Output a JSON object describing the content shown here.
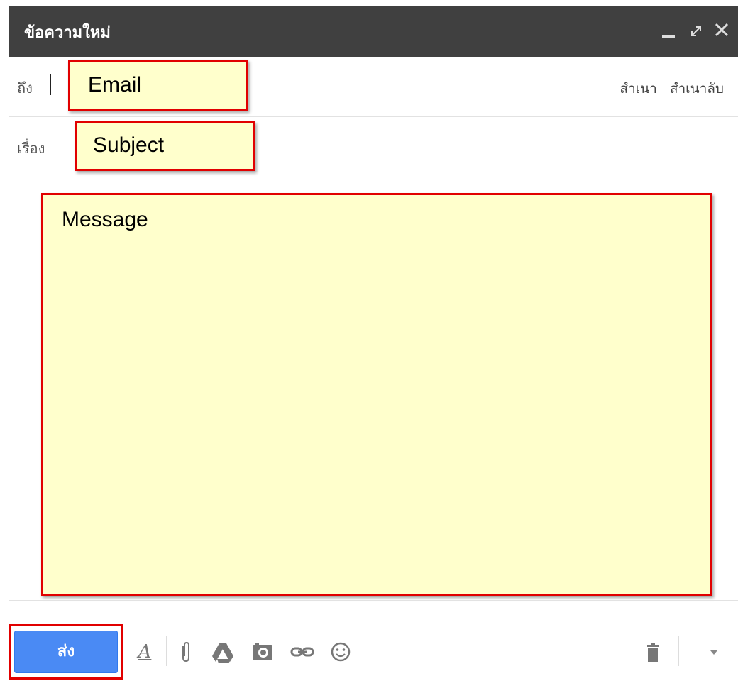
{
  "window": {
    "title": "ข้อความใหม่",
    "controls": {
      "minimize": "minimize-icon",
      "expand": "expand-icon",
      "close": "close-icon"
    }
  },
  "to_row": {
    "label": "ถึง",
    "field_text": "Email",
    "cc_label": "สำเนา",
    "bcc_label": "สำเนาลับ"
  },
  "subject_row": {
    "label": "เรื่อง",
    "field_text": "Subject"
  },
  "message": {
    "field_text": "Message"
  },
  "toolbar": {
    "send_label": "ส่ง",
    "icons": [
      "format-text-icon",
      "attach-icon",
      "drive-icon",
      "photo-icon",
      "link-icon",
      "emoji-icon",
      "trash-icon",
      "more-options-icon"
    ]
  },
  "colors": {
    "titlebar": "#404040",
    "send_button": "#4a8af4",
    "highlight_fill": "#ffffcc",
    "highlight_border": "#e10000"
  }
}
